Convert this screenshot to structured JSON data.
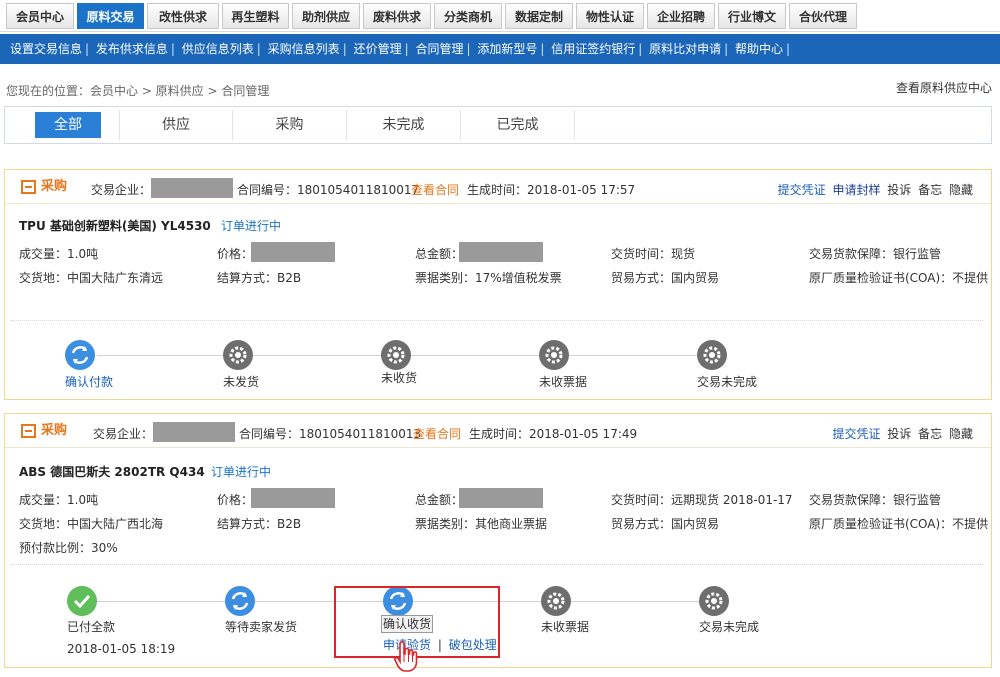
{
  "topnav": {
    "tabs": [
      "会员中心",
      "原料交易",
      "改性供求",
      "再生塑料",
      "助剂供应",
      "废料供求",
      "分类商机",
      "数据定制",
      "物性认证",
      "企业招聘",
      "行业博文",
      "合伙代理"
    ],
    "active": "原料交易"
  },
  "subnav": {
    "items": [
      "设置交易信息",
      "发布供求信息",
      "供应信息列表",
      "采购信息列表",
      "还价管理",
      "合同管理",
      "添加新型号",
      "信用证签约银行",
      "原料比对申请",
      "帮助中心"
    ],
    "separator": "|"
  },
  "breadcrumb": "您现在的位置：会员中心 > 原料供应 > 合同管理",
  "view_supply_link": "查看原料供应中心",
  "filter_tabs": [
    "全部",
    "供应",
    "采购",
    "未完成",
    "已完成"
  ],
  "cards": [
    {
      "type_label": "采购",
      "company_label": "交易企业：",
      "contract_no": "合同编号：1801054011810017",
      "view_contract": "查看合同",
      "created": "生成时间：2018-01-05 17:57",
      "links": [
        "提交凭证",
        "申请封样",
        "投诉",
        "备忘",
        "隐藏"
      ],
      "product": "TPU 基础创新塑料(美国) YL4530",
      "status": "订单进行中",
      "fields": {
        "qty": "成交量：1.0吨",
        "price": "价格：",
        "total": "总金额：",
        "delivery_time": "交货时间：现货",
        "guarantee": "交易货款保障：银行监管",
        "place": "交货地：中国大陆广东清远",
        "settle": "结算方式：B2B",
        "invoice": "票据类别：17%增值税发票",
        "trade": "贸易方式：国内贸易",
        "coa": "原厂质量检验证书(COA)：不提供"
      },
      "steps": [
        "确认付款",
        "未发货",
        "未收货",
        "未收票据",
        "交易未完成"
      ]
    },
    {
      "type_label": "采购",
      "company_label": "交易企业：",
      "contract_no": "合同编号：1801054011810013",
      "view_contract": "查看合同",
      "created": "生成时间：2018-01-05 17:49",
      "links": [
        "提交凭证",
        "投诉",
        "备忘",
        "隐藏"
      ],
      "product": "ABS 德国巴斯夫 2802TR Q434",
      "status": "订单进行中",
      "fields": {
        "qty": "成交量：1.0吨",
        "price": "价格：",
        "total": "总金额：",
        "delivery_time": "交货时间：远期现货 2018-01-17",
        "guarantee": "交易货款保障：银行监管",
        "place": "交货地：中国大陆广西北海",
        "settle": "结算方式：B2B",
        "invoice": "票据类别：其他商业票据",
        "trade": "贸易方式：国内贸易",
        "coa": "原厂质量检验证书(COA)：不提供",
        "prepay": "预付款比例：30%"
      },
      "steps": [
        "已付全款",
        "等待卖家发货",
        "确认收货",
        "未收票据",
        "交易未完成"
      ],
      "paid_time": "2018-01-05 18:19",
      "apply_inspect": "申请验货",
      "damage": "破包处理",
      "link_sep": "|"
    }
  ],
  "colors": {
    "brand_blue": "#1b66b9",
    "accent_orange": "#e8761a",
    "highlight_red": "#d9262b",
    "card_border": "#f1d690"
  },
  "icons": [
    "refresh-icon",
    "gear-icon",
    "check-icon",
    "hand-cursor-icon"
  ]
}
